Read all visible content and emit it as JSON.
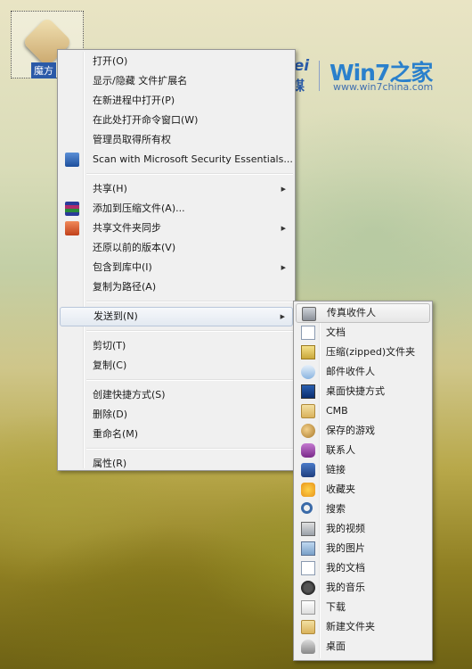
{
  "desktop": {
    "icon_label": "魔方"
  },
  "logo": {
    "ruanmei": "RuanMei",
    "ruanmei_cn": "软媒",
    "win7": "Win7之家",
    "url": "www.win7china.com"
  },
  "context_menu": {
    "items": [
      {
        "label": "打开(O)"
      },
      {
        "label": "显示/隐藏 文件扩展名"
      },
      {
        "label": "在新进程中打开(P)"
      },
      {
        "label": "在此处打开命令窗口(W)"
      },
      {
        "label": "管理员取得所有权"
      },
      {
        "label": "Scan with Microsoft Security Essentials...",
        "icon": "security-essentials-icon"
      },
      {
        "label": "共享(H)"
      },
      {
        "label": "添加到压缩文件(A)...",
        "icon": "winrar-icon"
      },
      {
        "label": "共享文件夹同步",
        "icon": "sync-icon"
      },
      {
        "label": "还原以前的版本(V)"
      },
      {
        "label": "包含到库中(I)"
      },
      {
        "label": "复制为路径(A)"
      },
      {
        "label": "发送到(N)"
      },
      {
        "label": "剪切(T)"
      },
      {
        "label": "复制(C)"
      },
      {
        "label": "创建快捷方式(S)"
      },
      {
        "label": "删除(D)"
      },
      {
        "label": "重命名(M)"
      },
      {
        "label": "属性(R)"
      }
    ]
  },
  "send_to_menu": {
    "items": [
      {
        "label": "传真收件人",
        "icon": "fax-icon"
      },
      {
        "label": "文档",
        "icon": "document-icon"
      },
      {
        "label": "压缩(zipped)文件夹",
        "icon": "zip-folder-icon"
      },
      {
        "label": "邮件收件人",
        "icon": "mail-icon"
      },
      {
        "label": "桌面快捷方式",
        "icon": "desktop-shortcut-icon"
      },
      {
        "label": "CMB",
        "icon": "folder-icon"
      },
      {
        "label": "保存的游戏",
        "icon": "saved-games-icon"
      },
      {
        "label": "联系人",
        "icon": "contacts-icon"
      },
      {
        "label": "链接",
        "icon": "links-icon"
      },
      {
        "label": "收藏夹",
        "icon": "favorites-icon"
      },
      {
        "label": "搜索",
        "icon": "search-icon"
      },
      {
        "label": "我的视频",
        "icon": "videos-icon"
      },
      {
        "label": "我的图片",
        "icon": "pictures-icon"
      },
      {
        "label": "我的文档",
        "icon": "my-documents-icon"
      },
      {
        "label": "我的音乐",
        "icon": "music-icon"
      },
      {
        "label": "下载",
        "icon": "downloads-icon"
      },
      {
        "label": "新建文件夹",
        "icon": "new-folder-icon"
      },
      {
        "label": "桌面",
        "icon": "desktop-icon"
      }
    ]
  },
  "colors": {
    "logo_blue": "#2a5ba8",
    "win7_blue": "#2a80cc",
    "highlight_border": "#b8c6da"
  }
}
